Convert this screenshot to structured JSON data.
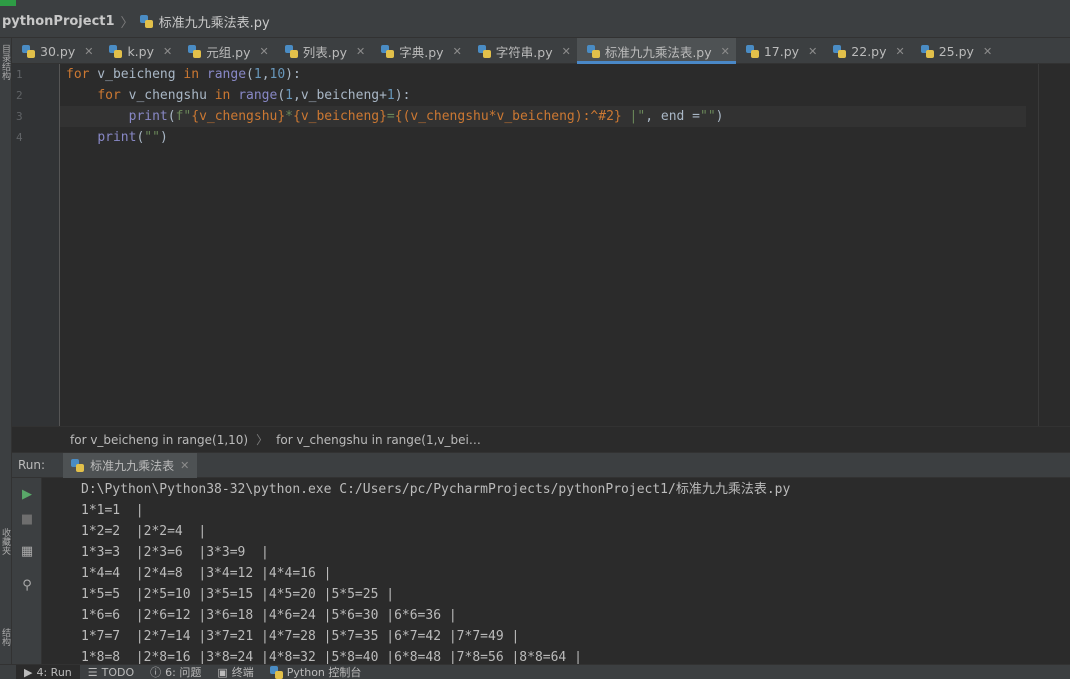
{
  "breadcrumb": {
    "project": "pythonProject1",
    "file": "标准九九乘法表.py"
  },
  "left_strip_labels": [
    "目录结构",
    "收藏夹",
    "结构"
  ],
  "tabs": [
    {
      "label": "30.py",
      "active": false
    },
    {
      "label": "k.py",
      "active": false
    },
    {
      "label": "元组.py",
      "active": false
    },
    {
      "label": "列表.py",
      "active": false
    },
    {
      "label": "字典.py",
      "active": false
    },
    {
      "label": "字符串.py",
      "active": false
    },
    {
      "label": "标准九九乘法表.py",
      "active": true
    },
    {
      "label": "17.py",
      "active": false
    },
    {
      "label": "22.py",
      "active": false
    },
    {
      "label": "25.py",
      "active": false
    }
  ],
  "editor": {
    "line_numbers": [
      "1",
      "2",
      "3",
      "4"
    ],
    "lines": [
      "for v_beicheng in range(1,10):",
      "    for v_chengshu in range(1,v_beicheng+1):",
      "        print(f\"{v_chengshu}*{v_beicheng}={(v_chengshu*v_beicheng):^#2} |\", end =\"\")",
      "    print(\"\")"
    ]
  },
  "code_breadcrumb": [
    "for v_beicheng in range(1,10)",
    "for v_chengshu in range(1,v_bei…"
  ],
  "run": {
    "label": "Run:",
    "tab": "标准九九乘法表",
    "command": "D:\\Python\\Python38-32\\python.exe C:/Users/pc/PycharmProjects/pythonProject1/标准九九乘法表.py",
    "output": [
      "1*1=1  |",
      "1*2=2  |2*2=4  |",
      "1*3=3  |2*3=6  |3*3=9  |",
      "1*4=4  |2*4=8  |3*4=12 |4*4=16 |",
      "1*5=5  |2*5=10 |3*5=15 |4*5=20 |5*5=25 |",
      "1*6=6  |2*6=12 |3*6=18 |4*6=24 |5*6=30 |6*6=36 |",
      "1*7=7  |2*7=14 |3*7=21 |4*7=28 |5*7=35 |6*7=42 |7*7=49 |",
      "1*8=8  |2*8=16 |3*8=24 |4*8=32 |5*8=40 |6*8=48 |7*8=56 |8*8=64 |"
    ]
  },
  "bottom_tools": [
    {
      "label": "4: Run",
      "icon": "play-icon",
      "active": true
    },
    {
      "label": "TODO",
      "icon": "list-icon",
      "active": false
    },
    {
      "label": "6: 问题",
      "icon": "info-icon",
      "active": false
    },
    {
      "label": "终端",
      "icon": "terminal-icon",
      "active": false
    },
    {
      "label": "Python 控制台",
      "icon": "python-icon",
      "active": false
    }
  ]
}
